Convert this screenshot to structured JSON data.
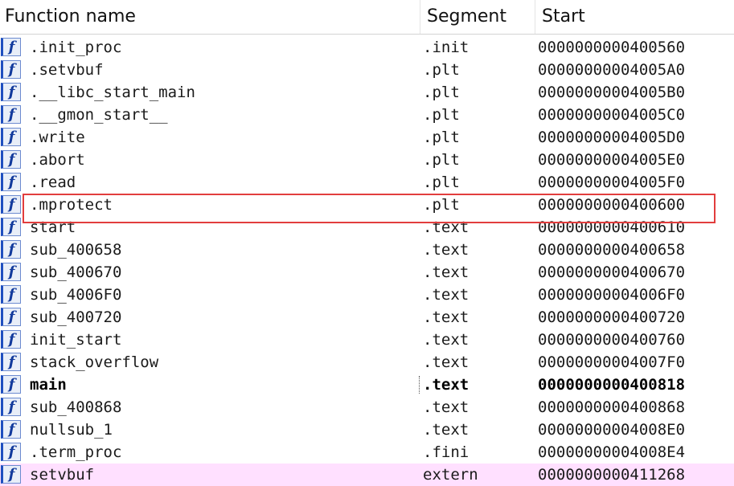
{
  "columns": {
    "name": "Function name",
    "segment": "Segment",
    "start": "Start"
  },
  "icon_glyph": "f",
  "rows": [
    {
      "name": ".init_proc",
      "segment": ".init",
      "start": "0000000000400560"
    },
    {
      "name": ".setvbuf",
      "segment": ".plt",
      "start": "00000000004005A0"
    },
    {
      "name": ".__libc_start_main",
      "segment": ".plt",
      "start": "00000000004005B0"
    },
    {
      "name": ".__gmon_start__",
      "segment": ".plt",
      "start": "00000000004005C0"
    },
    {
      "name": ".write",
      "segment": ".plt",
      "start": "00000000004005D0"
    },
    {
      "name": ".abort",
      "segment": ".plt",
      "start": "00000000004005E0"
    },
    {
      "name": ".read",
      "segment": ".plt",
      "start": "00000000004005F0"
    },
    {
      "name": ".mprotect",
      "segment": ".plt",
      "start": "0000000000400600"
    },
    {
      "name": "start",
      "segment": ".text",
      "start": "0000000000400610"
    },
    {
      "name": "sub_400658",
      "segment": ".text",
      "start": "0000000000400658"
    },
    {
      "name": "sub_400670",
      "segment": ".text",
      "start": "0000000000400670"
    },
    {
      "name": "sub_4006F0",
      "segment": ".text",
      "start": "00000000004006F0"
    },
    {
      "name": "sub_400720",
      "segment": ".text",
      "start": "0000000000400720"
    },
    {
      "name": "init_start",
      "segment": ".text",
      "start": "0000000000400760"
    },
    {
      "name": "stack_overflow",
      "segment": ".text",
      "start": "00000000004007F0"
    },
    {
      "name": "main",
      "segment": ".text",
      "start": "0000000000400818"
    },
    {
      "name": "sub_400868",
      "segment": ".text",
      "start": "0000000000400868"
    },
    {
      "name": "nullsub_1",
      "segment": ".text",
      "start": "00000000004008E0"
    },
    {
      "name": ".term_proc",
      "segment": ".fini",
      "start": "00000000004008E4"
    },
    {
      "name": "setvbuf",
      "segment": "extern",
      "start": "0000000000411268"
    }
  ],
  "colors": {
    "highlight": "#e23d3d",
    "extern_row": "#ffe0ff",
    "icon": "#1f4fbf"
  }
}
